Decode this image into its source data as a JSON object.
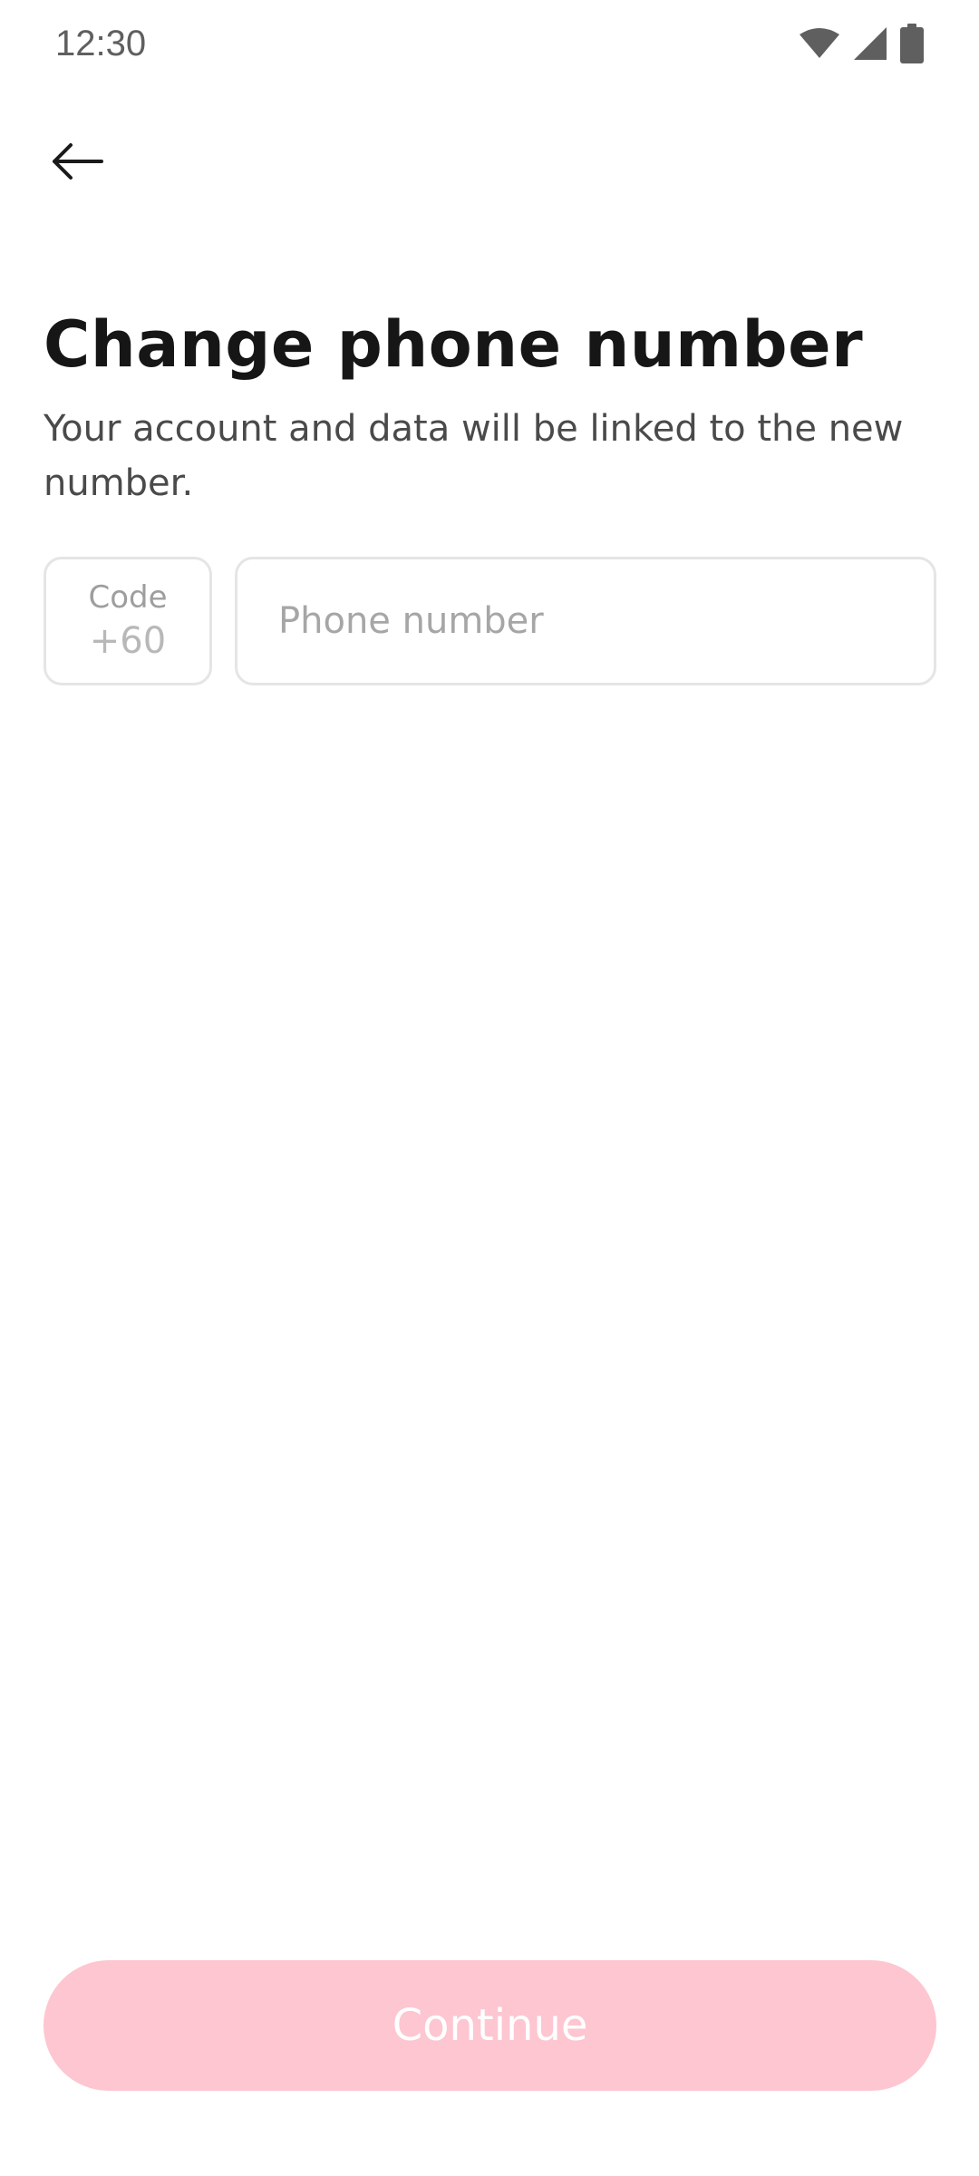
{
  "status_bar": {
    "time": "12:30",
    "icons": [
      "wifi-icon",
      "cellular-signal-icon",
      "battery-icon"
    ]
  },
  "header": {
    "back_icon": "arrow-left-icon"
  },
  "main": {
    "title": "Change phone number",
    "subtitle": "Your account and data will be linked to the new number.",
    "code_field": {
      "label": "Code",
      "value": "+60"
    },
    "phone_field": {
      "value": "",
      "placeholder": "Phone number"
    }
  },
  "footer": {
    "continue_label": "Continue"
  },
  "colors": {
    "continue_button_bg": "#fdc6d0",
    "continue_button_text": "#ffffff",
    "field_border": "#e5e5e5",
    "title_text": "#161616",
    "subtitle_text": "#4a4a4a",
    "placeholder_text": "#a6a6a6"
  }
}
